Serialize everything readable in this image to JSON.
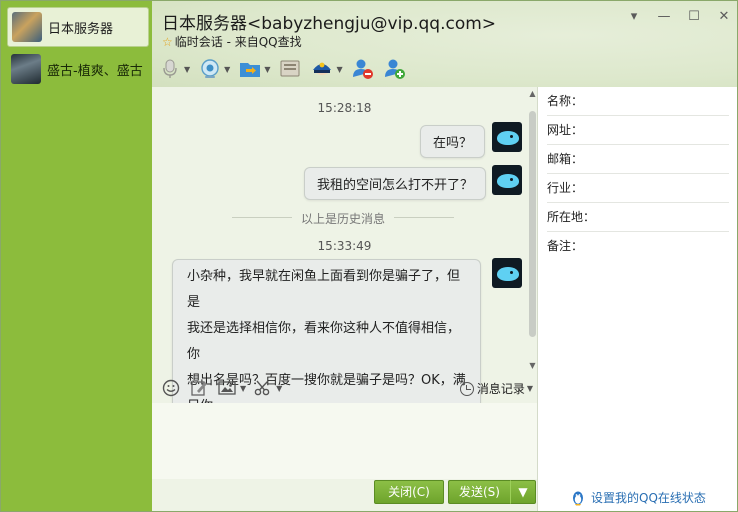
{
  "contacts": [
    {
      "name": "日本服务器"
    },
    {
      "name": "盛古-植爽、盛古"
    }
  ],
  "chat": {
    "title": "日本服务器<babyzhengju@vip.qq.com>",
    "subtitle": "临时会话 - 来自QQ查找"
  },
  "messages": {
    "ts1": "15:28:18",
    "msg1": "在吗？",
    "msg2": "我租的空间怎么打不开了？",
    "history": "以上是历史消息",
    "ts2": "15:33:49",
    "msg3_lines": [
      "小杂种，我早就在闲鱼上面看到你是骗子了，但是",
      "我还是选择相信你，看来你这种人不值得相信，你",
      "想出名是吗？百度一搜你就是骗子是吗？OK，满",
      "足你"
    ]
  },
  "input_toolbar": {
    "record_label": "消息记录"
  },
  "buttons": {
    "close": "关闭(C)",
    "send": "发送(S)"
  },
  "info": {
    "name": "名称：",
    "website": "网址：",
    "email": "邮箱：",
    "industry": "行业：",
    "location": "所在地：",
    "note": "备注："
  },
  "online_status": "设置我的QQ在线状态",
  "colors": {
    "sidebar": "#8cbc3c",
    "accent_green": "#7ab236",
    "link_blue": "#2a6fb3"
  }
}
